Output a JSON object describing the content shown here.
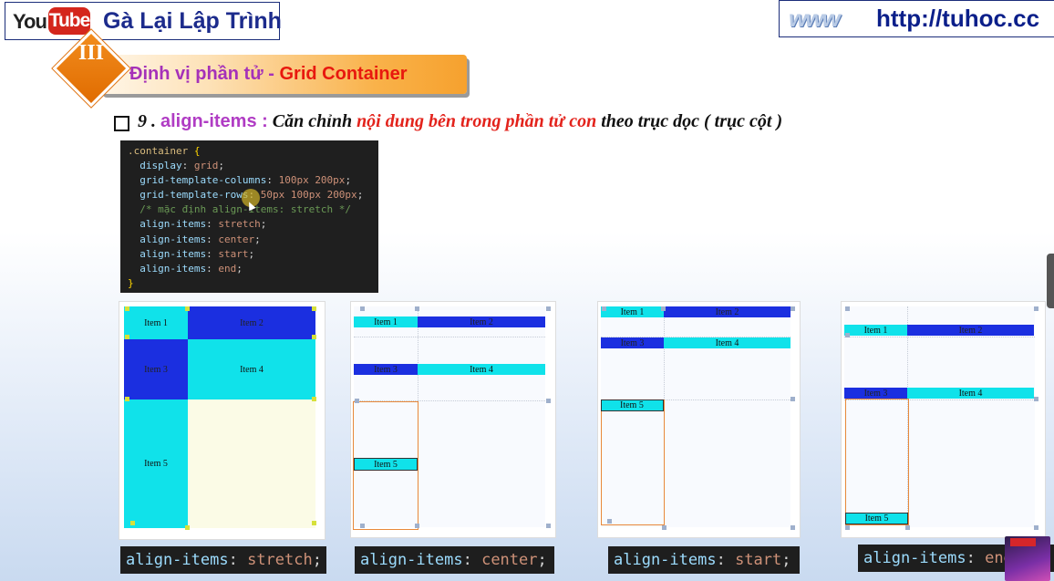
{
  "header": {
    "yt_you": "You",
    "yt_tube": "Tube",
    "channel": "Gà Lại Lập Trình",
    "www": "www",
    "url": "http://tuhoc.cc"
  },
  "banner": {
    "number": "III",
    "title_part1": "Định vị phần tử - ",
    "title_part2": "Grid Container"
  },
  "heading": {
    "number": "9 . ",
    "property": "align-items :",
    "text1": " Căn chỉnh ",
    "highlight": "nội dung bên trong phần tử con",
    "text2": " theo trục dọc ( trục cột )"
  },
  "code": {
    "selector": ".container",
    "open": " {",
    "lines": [
      {
        "prop": "display",
        "val": "grid"
      },
      {
        "prop": "grid-template-columns",
        "val": "100px 200px"
      },
      {
        "prop": "grid-template-rows",
        "val": "50px 100px 200px"
      }
    ],
    "comment": "/* mặc định align-items: stretch */",
    "align_lines": [
      {
        "prop": "align-items",
        "val": "stretch"
      },
      {
        "prop": "align-items",
        "val": "center"
      },
      {
        "prop": "align-items",
        "val": "start"
      },
      {
        "prop": "align-items",
        "val": "end"
      }
    ],
    "close": "}"
  },
  "items": [
    "Item 1",
    "Item 2",
    "Item 3",
    "Item 4",
    "Item 5"
  ],
  "labels": [
    {
      "prop": "align-items",
      "val": "stretch"
    },
    {
      "prop": "align-items",
      "val": "center"
    },
    {
      "prop": "align-items",
      "val": "start"
    },
    {
      "prop": "align-items",
      "val": "end"
    }
  ],
  "colors": {
    "cyan": "#10e2ea",
    "blue": "#1b2fe0",
    "accent_orange": "#f6a12e",
    "purple": "#a531b9",
    "red": "#e8180e"
  }
}
